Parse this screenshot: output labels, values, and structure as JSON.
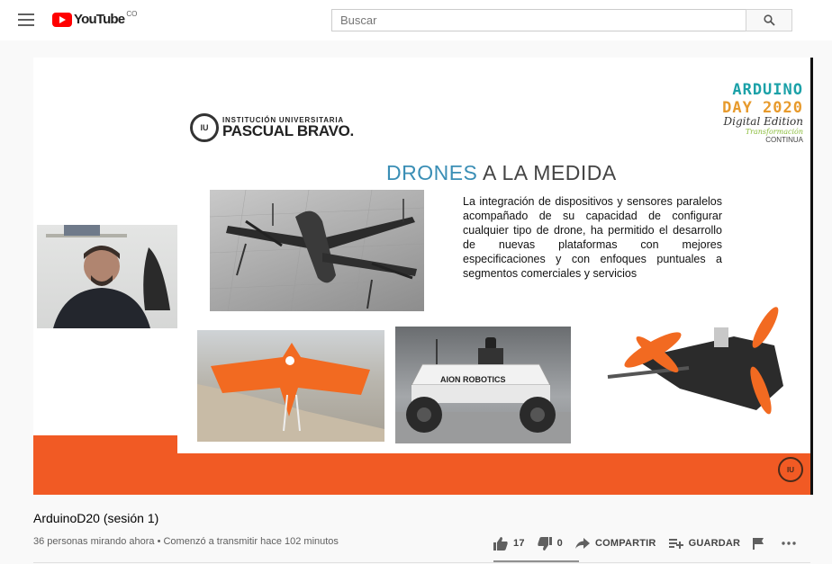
{
  "header": {
    "logo_text": "YouTube",
    "logo_country": "CO",
    "search_placeholder": "Buscar",
    "brand_color": "#ff0000"
  },
  "slide": {
    "event_logo_line1": "ARDUINO",
    "event_logo_line2": "DAY 2020",
    "event_logo_line3": "Digital Edition",
    "event_logo_line4": "Transformación",
    "event_logo_line5": "CONTINUA",
    "institution_line1": "INSTITUCIÓN UNIVERSITARIA",
    "institution_line2": "PASCUAL BRAVO.",
    "title_part1": "DRONES",
    "title_part2": " A LA MEDIDA",
    "body": "La integración de dispositivos y sensores paralelos acompañado de su capacidad de configurar cualquier tipo de drone, ha permitido el desarrollo de nuevas plataformas con mejores especificaciones y con enfoques puntuales a segmentos comerciales y servicios",
    "robot_label": "AION ROBOTICS",
    "accent_color": "#f15a24"
  },
  "video": {
    "title": "ArduinoD20 (sesión 1)",
    "meta": "36 personas mirando ahora • Comenzó a transmitir hace 102 minutos",
    "likes": "17",
    "dislikes": "0",
    "share_label": "COMPARTIR",
    "save_label": "GUARDAR"
  }
}
